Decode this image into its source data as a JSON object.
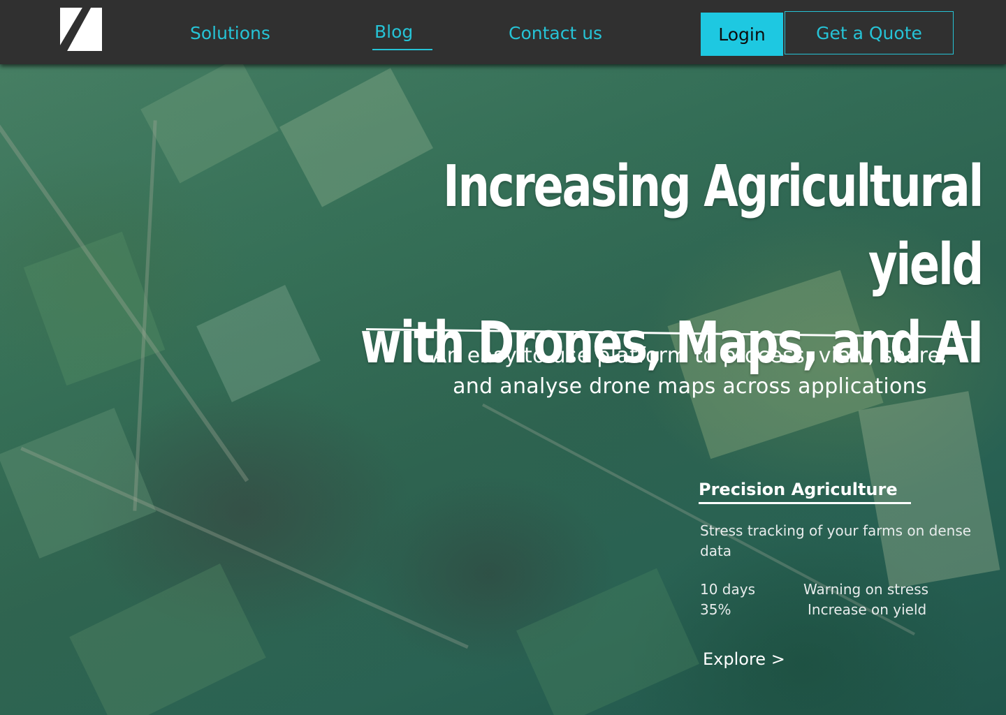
{
  "nav": {
    "logo_icon": "brand-logo-icon",
    "links": [
      {
        "label": "Solutions"
      },
      {
        "label": "Blog"
      },
      {
        "label": "Contact us"
      }
    ],
    "login_label": "Login",
    "quote_label": "Get a Quote",
    "accent_color": "#26c3d6"
  },
  "hero": {
    "title_line1": "Increasing Agricultural yield",
    "title_line2": "with Drones, Maps, and AI",
    "subtitle_line1": "An easy to use platform to process, view, share,",
    "subtitle_line2": "and analyse drone maps across applications"
  },
  "feature": {
    "title": "Precision Agriculture",
    "description": "Stress tracking of your farms on dense data",
    "stats": [
      {
        "value": "10 days",
        "label": "Warning on stress"
      },
      {
        "value": "35%",
        "label": "Increase on yield"
      }
    ],
    "cta_label": "Explore >"
  }
}
